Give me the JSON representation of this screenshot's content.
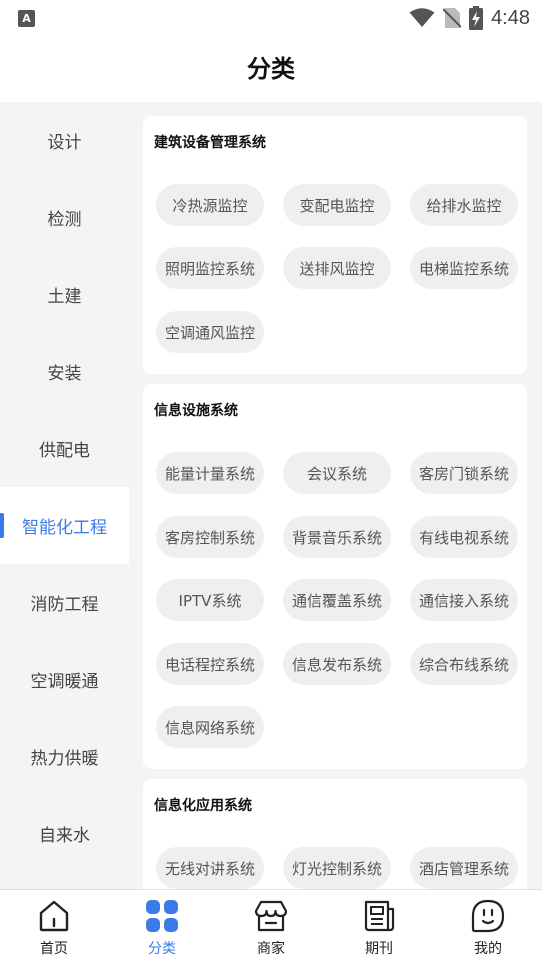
{
  "status_bar": {
    "time": "4:48",
    "app_badge": "A"
  },
  "header": {
    "title": "分类"
  },
  "sidebar": {
    "items": [
      {
        "label": "设计",
        "active": false
      },
      {
        "label": "检测",
        "active": false
      },
      {
        "label": "土建",
        "active": false
      },
      {
        "label": "安装",
        "active": false
      },
      {
        "label": "供配电",
        "active": false
      },
      {
        "label": "智能化工程",
        "active": true
      },
      {
        "label": "消防工程",
        "active": false
      },
      {
        "label": "空调暖通",
        "active": false
      },
      {
        "label": "热力供暖",
        "active": false
      },
      {
        "label": "自来水",
        "active": false
      }
    ]
  },
  "content": {
    "sections": [
      {
        "title": "建筑设备管理系统",
        "chips": [
          "冷热源监控",
          "变配电监控",
          "给排水监控",
          "照明监控系统",
          "送排风监控",
          "电梯监控系统",
          "空调通风监控"
        ]
      },
      {
        "title": "信息设施系统",
        "chips": [
          "能量计量系统",
          "会议系统",
          "客房门锁系统",
          "客房控制系统",
          "背景音乐系统",
          "有线电视系统",
          "IPTV系统",
          "通信覆盖系统",
          "通信接入系统",
          "电话程控系统",
          "信息发布系统",
          "综合布线系统",
          "信息网络系统"
        ]
      },
      {
        "title": "信息化应用系统",
        "chips": [
          "无线对讲系统",
          "灯光控制系统",
          "酒店管理系统"
        ]
      }
    ]
  },
  "bottom_nav": {
    "items": [
      {
        "label": "首页",
        "icon": "home-icon",
        "active": false
      },
      {
        "label": "分类",
        "icon": "category-icon",
        "active": true
      },
      {
        "label": "商家",
        "icon": "store-icon",
        "active": false
      },
      {
        "label": "期刊",
        "icon": "journal-icon",
        "active": false
      },
      {
        "label": "我的",
        "icon": "profile-icon",
        "active": false
      }
    ]
  },
  "colors": {
    "accent": "#3a7be8",
    "chip_bg": "#efefef",
    "page_bg": "#f4f4f4"
  }
}
